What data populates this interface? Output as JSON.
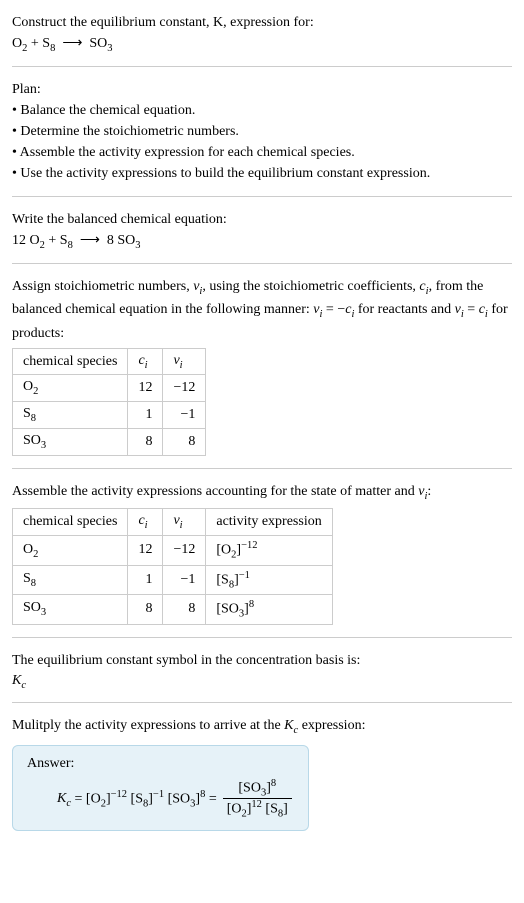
{
  "intro": {
    "line1": "Construct the equilibrium constant, K, expression for:",
    "formula_html": "O<span class='sub'>2</span> + S<span class='sub'>8</span> &nbsp;⟶&nbsp; SO<span class='sub'>3</span>"
  },
  "plan": {
    "heading": "Plan:",
    "items": [
      "Balance the chemical equation.",
      "Determine the stoichiometric numbers.",
      "Assemble the activity expression for each chemical species.",
      "Use the activity expressions to build the equilibrium constant expression."
    ]
  },
  "balanced": {
    "heading": "Write the balanced chemical equation:",
    "formula_html": "12 O<span class='sub'>2</span> + S<span class='sub'>8</span> &nbsp;⟶&nbsp; 8 SO<span class='sub'>3</span>"
  },
  "stoich": {
    "text_html": "Assign stoichiometric numbers, <span class='italic'>ν<span class='sub'>i</span></span>, using the stoichiometric coefficients, <span class='italic'>c<span class='sub'>i</span></span>, from the balanced chemical equation in the following manner: <span class='italic'>ν<span class='sub'>i</span></span> = −<span class='italic'>c<span class='sub'>i</span></span> for reactants and <span class='italic'>ν<span class='sub'>i</span></span> = <span class='italic'>c<span class='sub'>i</span></span> for products:",
    "headers": [
      "chemical species",
      "<span class='italic'>c<span class='sub'>i</span></span>",
      "<span class='italic'>ν<span class='sub'>i</span></span>"
    ],
    "rows": [
      {
        "species_html": "O<span class='sub'>2</span>",
        "c": "12",
        "v": "−12"
      },
      {
        "species_html": "S<span class='sub'>8</span>",
        "c": "1",
        "v": "−1"
      },
      {
        "species_html": "SO<span class='sub'>3</span>",
        "c": "8",
        "v": "8"
      }
    ]
  },
  "activity": {
    "text_html": "Assemble the activity expressions accounting for the state of matter and <span class='italic'>ν<span class='sub'>i</span></span>:",
    "headers": [
      "chemical species",
      "<span class='italic'>c<span class='sub'>i</span></span>",
      "<span class='italic'>ν<span class='sub'>i</span></span>",
      "activity expression"
    ],
    "rows": [
      {
        "species_html": "O<span class='sub'>2</span>",
        "c": "12",
        "v": "−12",
        "expr_html": "[O<span class='sub'>2</span>]<span class='sup'>−12</span>"
      },
      {
        "species_html": "S<span class='sub'>8</span>",
        "c": "1",
        "v": "−1",
        "expr_html": "[S<span class='sub'>8</span>]<span class='sup'>−1</span>"
      },
      {
        "species_html": "SO<span class='sub'>3</span>",
        "c": "8",
        "v": "8",
        "expr_html": "[SO<span class='sub'>3</span>]<span class='sup'>8</span>"
      }
    ]
  },
  "symbol": {
    "heading": "The equilibrium constant symbol in the concentration basis is:",
    "symbol_html": "<span class='italic'>K<span class='sub'>c</span></span>"
  },
  "multiply": {
    "heading_html": "Mulitply the activity expressions to arrive at the <span class='italic'>K<span class='sub'>c</span></span> expression:"
  },
  "answer": {
    "label": "Answer:",
    "lhs_html": "<span class='italic'>K<span class='sub'>c</span></span> = [O<span class='sub'>2</span>]<span class='sup'>−12</span> [S<span class='sub'>8</span>]<span class='sup'>−1</span> [SO<span class='sub'>3</span>]<span class='sup'>8</span> =",
    "frac_num_html": "[SO<span class='sub'>3</span>]<span class='sup'>8</span>",
    "frac_den_html": "[O<span class='sub'>2</span>]<span class='sup'>12</span> [S<span class='sub'>8</span>]"
  }
}
